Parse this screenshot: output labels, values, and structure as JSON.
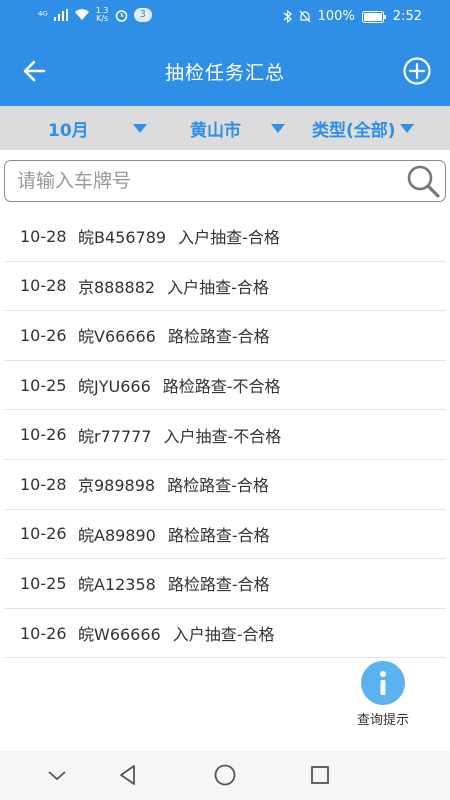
{
  "status_bar": {
    "signal_text": "⁴ᴳ",
    "speed_value": "1.3",
    "speed_unit": "K/s",
    "notification_count": "3",
    "battery": "100%",
    "time": "2:52"
  },
  "app_bar": {
    "title": "抽检任务汇总"
  },
  "filters": {
    "month": "10月",
    "city": "黄山市",
    "type": "类型(全部)"
  },
  "search": {
    "placeholder": "请输入车牌号",
    "value": ""
  },
  "records": [
    {
      "date": "10-28",
      "plate": "皖B456789",
      "result": "入户抽查-合格"
    },
    {
      "date": "10-28",
      "plate": "京888882",
      "result": "入户抽查-合格"
    },
    {
      "date": "10-26",
      "plate": "皖V66666",
      "result": "路检路查-合格"
    },
    {
      "date": "10-25",
      "plate": "皖JYU666",
      "result": "路检路查-不合格"
    },
    {
      "date": "10-26",
      "plate": "皖r77777",
      "result": "入户抽查-不合格"
    },
    {
      "date": "10-28",
      "plate": "京989898",
      "result": "路检路查-合格"
    },
    {
      "date": "10-26",
      "plate": "皖A89890",
      "result": "路检路查-合格"
    },
    {
      "date": "10-25",
      "plate": "皖A12358",
      "result": "路检路查-合格"
    },
    {
      "date": "10-26",
      "plate": "皖W66666",
      "result": "入户抽查-合格"
    }
  ],
  "fab": {
    "label": "查询提示"
  },
  "colors": {
    "primary": "#2f8fe6",
    "filter_bg": "#dcdcdc",
    "info": "#5ab3ee"
  }
}
